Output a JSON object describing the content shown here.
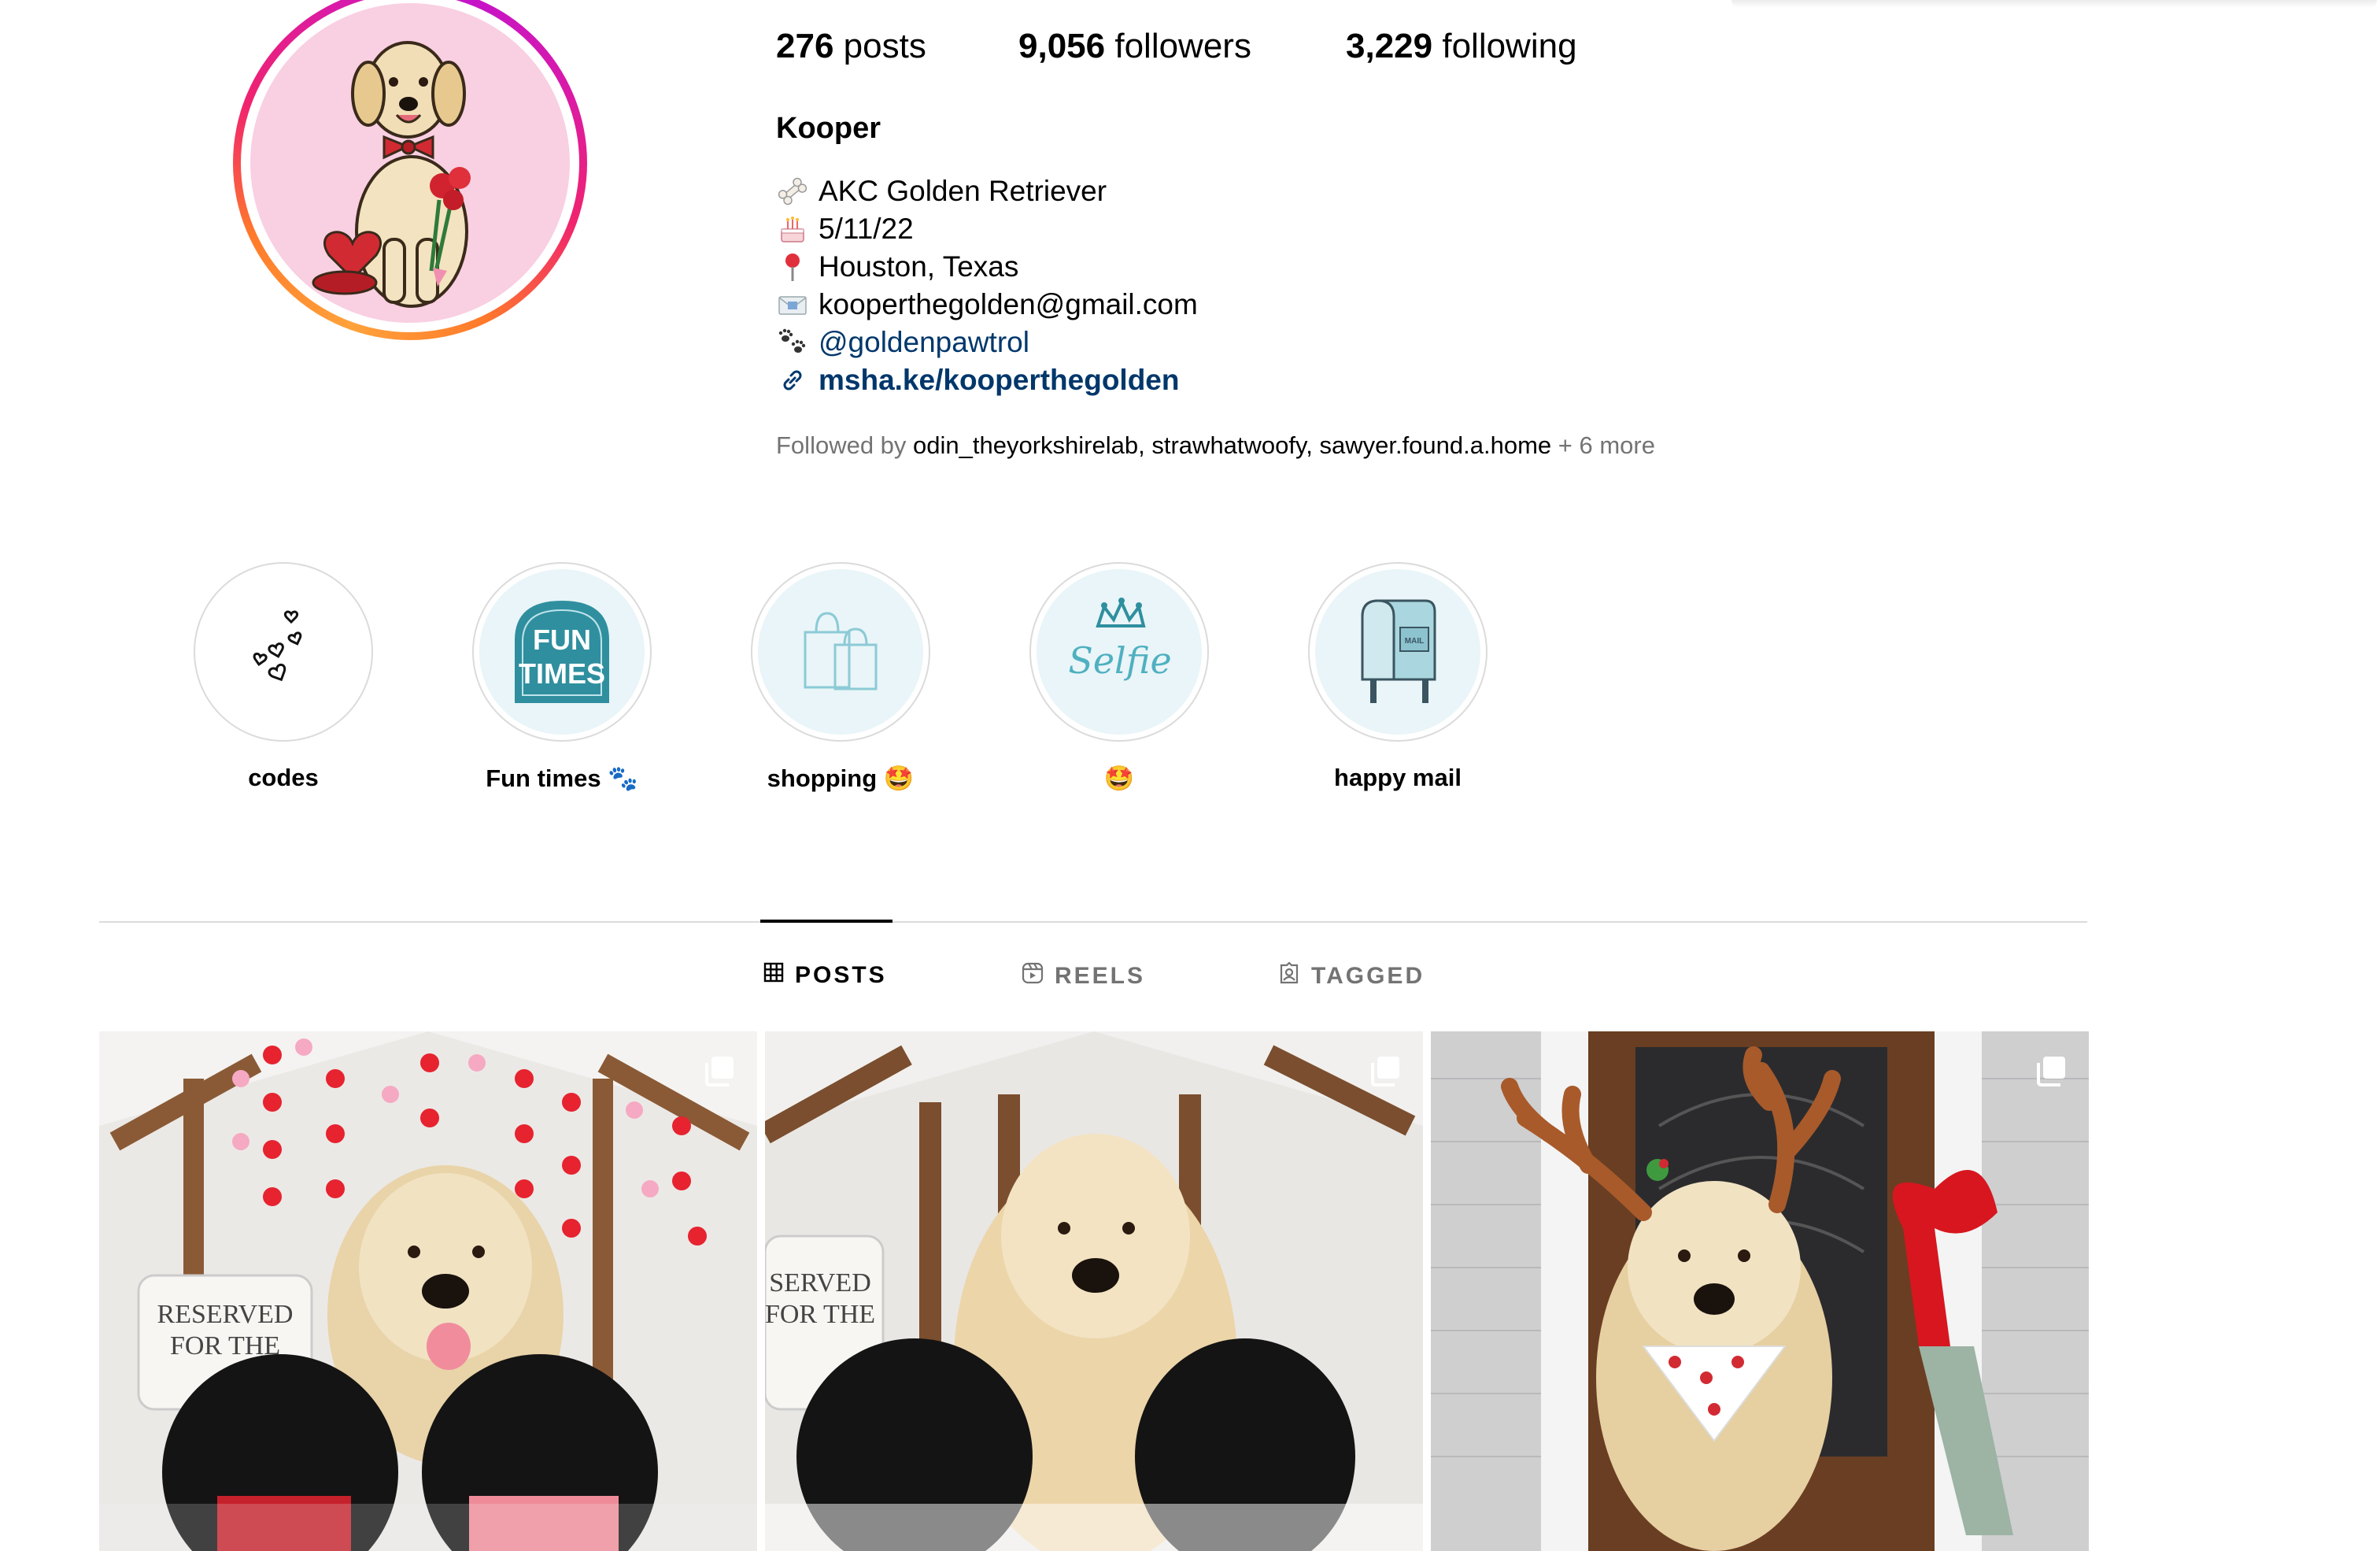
{
  "profile": {
    "stats": {
      "posts_count": "276",
      "posts_label": "posts",
      "followers_count": "9,056",
      "followers_label": "followers",
      "following_count": "3,229",
      "following_label": "following"
    },
    "display_name": "Kooper",
    "bio": {
      "line1_icon": "bone-icon",
      "line1": "AKC Golden Retriever",
      "line2_icon": "birthday-cake-icon",
      "line2": "5/11/22",
      "line3_icon": "location-pin-icon",
      "line3": "Houston, Texas",
      "line4_icon": "envelope-icon",
      "line4": "kooperthegolden@gmail.com",
      "line5_icon": "paw-prints-icon",
      "line5": "@goldenpawtrol",
      "link_icon": "link-icon",
      "link": "msha.ke/kooperthegolden"
    },
    "followed_by": {
      "prefix": "Followed by",
      "users": [
        "odin_theyorkshirelab",
        "strawhatwoofy",
        "sawyer.found.a.home"
      ],
      "sep1": ",",
      "sep2": ",",
      "suffix": "+ 6 more"
    }
  },
  "highlights": [
    {
      "label": "codes",
      "icon": "hearts-doodle-icon"
    },
    {
      "label": "Fun times 🐾",
      "icon": "fun-times-sign-icon",
      "sign_line1": "FUN",
      "sign_line2": "TIMES"
    },
    {
      "label": "shopping 🤩",
      "icon": "shopping-bags-icon"
    },
    {
      "label": "🤩",
      "icon": "selfie-crown-icon",
      "text": "Selfie"
    },
    {
      "label": "happy mail",
      "icon": "mailbox-icon",
      "mailbox_text": "MAIL"
    }
  ],
  "tabs": [
    {
      "label": "POSTS",
      "icon": "grid-icon",
      "active": true
    },
    {
      "label": "REELS",
      "icon": "reels-icon",
      "active": false
    },
    {
      "label": "TAGGED",
      "icon": "tagged-icon",
      "active": false
    }
  ],
  "posts": [
    {
      "type": "carousel",
      "icon": "multiple-photos-icon",
      "sign_line1": "RESERVED",
      "sign_line2": "FOR THE"
    },
    {
      "type": "carousel",
      "icon": "multiple-photos-icon",
      "sign_line1": "SERVED",
      "sign_line2": "FOR THE"
    },
    {
      "type": "carousel",
      "icon": "multiple-photos-icon"
    }
  ],
  "colors": {
    "link": "#00376b",
    "muted": "#737373",
    "divider": "#dbdbdb",
    "ring_start": "#ffa23b",
    "ring_end": "#c513c9",
    "highlight_teal": "#2f8f9f",
    "avatar_bg": "#f9cfe2"
  }
}
